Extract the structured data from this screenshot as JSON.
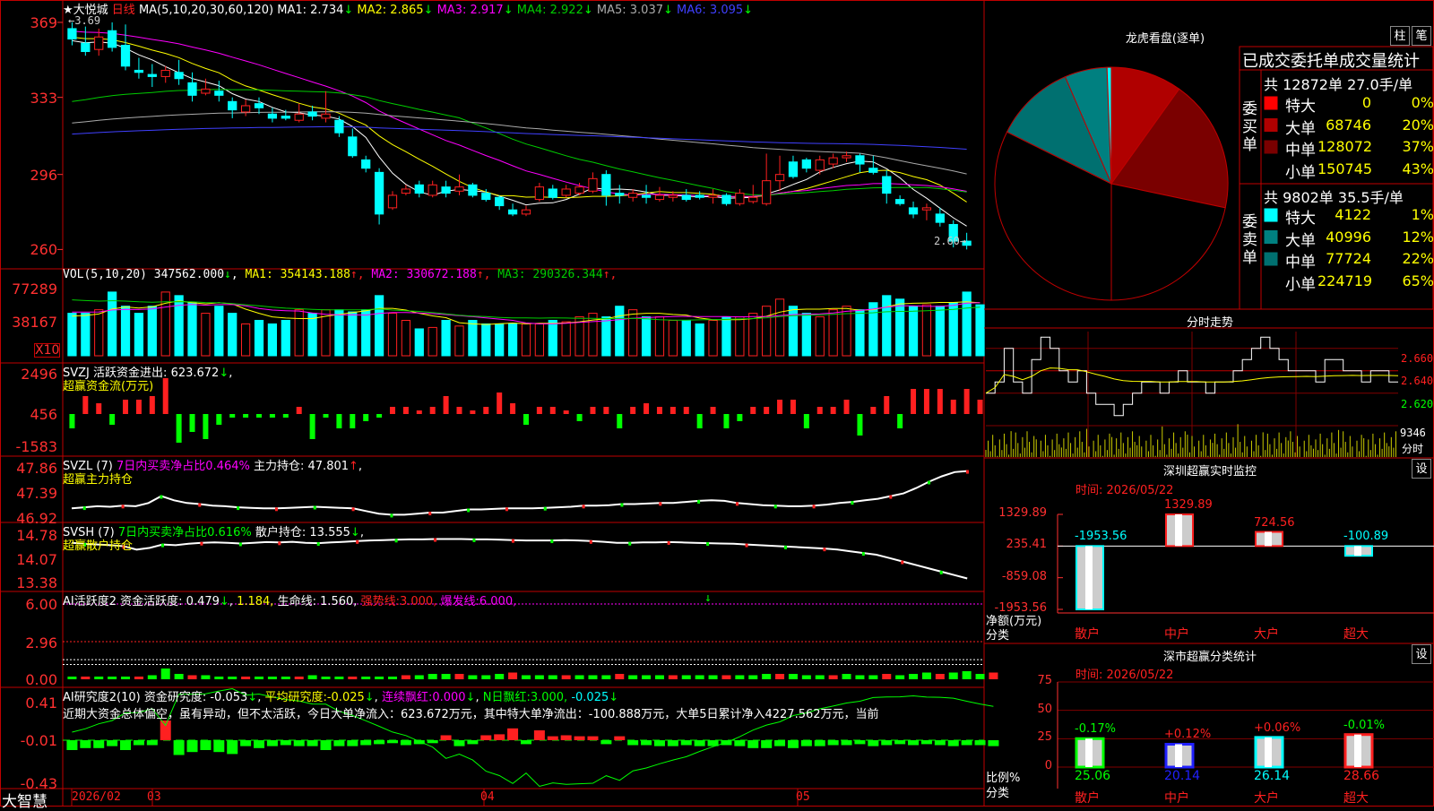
{
  "stock": {
    "name": "★大悦城",
    "period": "日线",
    "low_marker": "2.60→",
    "high_marker": "←3.69"
  },
  "colors": {
    "up": "#ff2020",
    "down": "#00ffff",
    "frame": "#c00000",
    "axis": "#ff3030",
    "ma1": "#ffffff",
    "ma2": "#ffff00",
    "ma3": "#ff00ff",
    "ma4": "#00cc00",
    "ma5": "#aaaaaa",
    "ma6": "#4040ff"
  },
  "main_chart": {
    "ma_header": {
      "label": "MA(5,10,20,30,60,120)",
      "items": [
        {
          "name": "MA1:",
          "value": "2.734",
          "arrow": "↓",
          "color": "#ffffff"
        },
        {
          "name": "MA2:",
          "value": "2.865",
          "arrow": "↓",
          "color": "#ffff00"
        },
        {
          "name": "MA3:",
          "value": "2.917",
          "arrow": "↓",
          "color": "#ff00ff"
        },
        {
          "name": "MA4:",
          "value": "2.922",
          "arrow": "↓",
          "color": "#00cc00"
        },
        {
          "name": "MA5:",
          "value": "3.037",
          "arrow": "↓",
          "color": "#aaaaaa"
        },
        {
          "name": "MA6:",
          "value": "3.095",
          "arrow": "↓",
          "color": "#4040ff"
        }
      ]
    },
    "y_ticks": [
      "369",
      "333",
      "296",
      "260"
    ],
    "y_range": [
      2.55,
      3.72
    ],
    "candles": [
      [
        3.66,
        3.69,
        3.58,
        3.61
      ],
      [
        3.59,
        3.67,
        3.53,
        3.55
      ],
      [
        3.56,
        3.66,
        3.53,
        3.62
      ],
      [
        3.65,
        3.69,
        3.55,
        3.57
      ],
      [
        3.58,
        3.68,
        3.46,
        3.48
      ],
      [
        3.46,
        3.52,
        3.42,
        3.45
      ],
      [
        3.44,
        3.49,
        3.38,
        3.43
      ],
      [
        3.43,
        3.48,
        3.4,
        3.46
      ],
      [
        3.45,
        3.51,
        3.39,
        3.42
      ],
      [
        3.4,
        3.45,
        3.31,
        3.34
      ],
      [
        3.35,
        3.42,
        3.34,
        3.37
      ],
      [
        3.36,
        3.41,
        3.31,
        3.34
      ],
      [
        3.31,
        3.33,
        3.23,
        3.27
      ],
      [
        3.26,
        3.32,
        3.24,
        3.29
      ],
      [
        3.3,
        3.33,
        3.25,
        3.28
      ],
      [
        3.25,
        3.28,
        3.21,
        3.23
      ],
      [
        3.24,
        3.27,
        3.22,
        3.23
      ],
      [
        3.22,
        3.3,
        3.21,
        3.25
      ],
      [
        3.26,
        3.29,
        3.22,
        3.24
      ],
      [
        3.23,
        3.36,
        3.21,
        3.25
      ],
      [
        3.22,
        3.24,
        3.14,
        3.16
      ],
      [
        3.14,
        3.18,
        3.04,
        3.05
      ],
      [
        3.03,
        3.05,
        2.97,
        2.99
      ],
      [
        2.97,
        2.99,
        2.72,
        2.77
      ],
      [
        2.8,
        2.88,
        2.79,
        2.86
      ],
      [
        2.87,
        2.91,
        2.86,
        2.89
      ],
      [
        2.91,
        2.93,
        2.85,
        2.87
      ],
      [
        2.86,
        2.93,
        2.85,
        2.91
      ],
      [
        2.9,
        2.93,
        2.85,
        2.87
      ],
      [
        2.88,
        2.96,
        2.86,
        2.9
      ],
      [
        2.91,
        2.92,
        2.85,
        2.86
      ],
      [
        2.87,
        2.89,
        2.83,
        2.84
      ],
      [
        2.85,
        2.86,
        2.79,
        2.81
      ],
      [
        2.79,
        2.82,
        2.76,
        2.77
      ],
      [
        2.77,
        2.81,
        2.76,
        2.79
      ],
      [
        2.84,
        2.92,
        2.83,
        2.9
      ],
      [
        2.89,
        2.91,
        2.84,
        2.85
      ],
      [
        2.86,
        2.91,
        2.85,
        2.89
      ],
      [
        2.87,
        2.92,
        2.86,
        2.9
      ],
      [
        2.88,
        2.97,
        2.87,
        2.94
      ],
      [
        2.96,
        2.98,
        2.81,
        2.86
      ],
      [
        2.87,
        2.91,
        2.82,
        2.86
      ],
      [
        2.85,
        2.89,
        2.83,
        2.87
      ],
      [
        2.86,
        2.91,
        2.82,
        2.85
      ],
      [
        2.84,
        2.9,
        2.83,
        2.86
      ],
      [
        2.85,
        2.88,
        2.83,
        2.86
      ],
      [
        2.86,
        2.89,
        2.83,
        2.84
      ],
      [
        2.86,
        2.88,
        2.84,
        2.85
      ],
      [
        2.85,
        2.89,
        2.82,
        2.86
      ],
      [
        2.86,
        2.87,
        2.81,
        2.82
      ],
      [
        2.82,
        2.89,
        2.81,
        2.87
      ],
      [
        2.83,
        2.91,
        2.82,
        2.85
      ],
      [
        2.82,
        3.06,
        2.81,
        2.93
      ],
      [
        2.93,
        3.05,
        2.88,
        2.96
      ],
      [
        3.02,
        3.05,
        2.94,
        2.95
      ],
      [
        3.03,
        3.04,
        2.97,
        2.99
      ],
      [
        2.98,
        3.05,
        2.96,
        3.03
      ],
      [
        3.01,
        3.06,
        2.99,
        3.04
      ],
      [
        3.04,
        3.07,
        3.02,
        3.05
      ],
      [
        3.05,
        3.06,
        2.97,
        3.01
      ],
      [
        2.99,
        3.05,
        2.96,
        2.97
      ],
      [
        2.95,
        2.98,
        2.82,
        2.87
      ],
      [
        2.84,
        2.86,
        2.81,
        2.82
      ],
      [
        2.8,
        2.83,
        2.75,
        2.77
      ],
      [
        2.79,
        2.82,
        2.74,
        2.8
      ],
      [
        2.77,
        2.8,
        2.71,
        2.73
      ],
      [
        2.72,
        2.74,
        2.61,
        2.64
      ],
      [
        2.64,
        2.68,
        2.6,
        2.62
      ]
    ]
  },
  "volume": {
    "header": {
      "label": "VOL(5,10,20)",
      "value": "347562.000",
      "arrow": "↓",
      "items": [
        {
          "name": "MA1:",
          "value": "354143.188",
          "arrow": "↑",
          "color": "#ffff00"
        },
        {
          "name": "MA2:",
          "value": "330672.188",
          "arrow": "↑",
          "color": "#ff00ff"
        },
        {
          "name": "MA3:",
          "value": "290326.344",
          "arrow": "↑",
          "color": "#00cc00"
        }
      ]
    },
    "y_ticks": [
      "77289",
      "38167"
    ],
    "unit": "X10",
    "bars": [
      0.6,
      0.6,
      0.65,
      0.9,
      0.7,
      0.6,
      0.7,
      0.9,
      0.85,
      0.75,
      0.6,
      0.7,
      0.6,
      0.45,
      0.5,
      0.45,
      0.5,
      0.65,
      0.6,
      0.65,
      0.65,
      0.62,
      0.65,
      0.85,
      0.6,
      0.5,
      0.38,
      0.4,
      0.5,
      0.42,
      0.5,
      0.45,
      0.45,
      0.45,
      0.45,
      0.45,
      0.5,
      0.48,
      0.55,
      0.6,
      0.55,
      0.7,
      0.65,
      0.55,
      0.55,
      0.5,
      0.5,
      0.45,
      0.5,
      0.55,
      0.55,
      0.6,
      0.7,
      0.8,
      0.7,
      0.6,
      0.55,
      0.65,
      0.7,
      0.65,
      0.75,
      0.85,
      0.8,
      0.7,
      0.72,
      0.7,
      0.75,
      0.9,
      0.72
    ]
  },
  "svzj": {
    "header_label": "SVZJ",
    "header_name": "活跃资金进出:",
    "header_value": "623.672",
    "header_arrow": "↓",
    "subtitle": "超赢资金流(万元)",
    "y_ticks": [
      "2496",
      "456",
      "-1583"
    ],
    "bars": [
      -0.4,
      0.5,
      0.3,
      -0.3,
      0.4,
      0.4,
      0.5,
      1.0,
      -0.8,
      -0.5,
      -0.7,
      -0.3,
      -0.1,
      -0.1,
      -0.1,
      -0.1,
      -0.1,
      0.2,
      -0.7,
      -0.1,
      -0.4,
      -0.4,
      -0.2,
      -0.1,
      0.2,
      0.2,
      0.1,
      0.2,
      0.5,
      0.2,
      0.1,
      0.2,
      0.6,
      0.3,
      -0.3,
      0.2,
      0.2,
      0.1,
      -0.2,
      0.2,
      0.2,
      -0.4,
      0.2,
      0.3,
      0.2,
      0.2,
      0.2,
      -0.4,
      0.2,
      -0.4,
      -0.2,
      0.2,
      0.2,
      0.4,
      0.4,
      -0.4,
      0.2,
      0.2,
      0.4,
      -0.6,
      0.2,
      0.5,
      -0.4,
      0.7,
      0.7,
      0.7,
      0.4,
      0.7,
      0.4
    ]
  },
  "svzl": {
    "header_label": "SVZL (7)",
    "header_pct_name": "7日内买卖净占比",
    "header_pct": "0.464%",
    "header_name": "主力持仓:",
    "header_value": "47.801",
    "header_arrow": "↑",
    "subtitle": "超赢主力持仓",
    "y_ticks": [
      "47.86",
      "47.39",
      "46.92"
    ],
    "line": [
      47.1,
      47.12,
      47.14,
      47.13,
      47.15,
      47.14,
      47.2,
      47.33,
      47.25,
      47.2,
      47.18,
      47.15,
      47.14,
      47.12,
      47.11,
      47.1,
      47.1,
      47.11,
      47.12,
      47.13,
      47.12,
      47.11,
      47.1,
      47.05,
      47.0,
      46.98,
      46.98,
      47.0,
      47.02,
      47.02,
      47.05,
      47.08,
      47.08,
      47.09,
      47.1,
      47.1,
      47.1,
      47.11,
      47.12,
      47.13,
      47.15,
      47.15,
      47.16,
      47.18,
      47.18,
      47.19,
      47.2,
      47.2,
      47.22,
      47.24,
      47.25,
      47.24,
      47.2,
      47.18,
      47.16,
      47.15,
      47.14,
      47.14,
      47.15,
      47.17,
      47.2,
      47.22,
      47.25,
      47.28,
      47.33,
      47.38,
      47.48,
      47.6,
      47.7,
      47.78,
      47.8
    ]
  },
  "svsh": {
    "header_label": "SVSH (7)",
    "header_pct_name": "7日内买卖净占比",
    "header_pct": "0.616%",
    "header_name": "散户持仓:",
    "header_value": "13.555",
    "header_arrow": "↓",
    "subtitle": "超赢散户持仓",
    "y_ticks": [
      "14.78",
      "14.07",
      "13.38"
    ],
    "line": [
      14.55,
      14.52,
      14.5,
      14.48,
      14.45,
      14.35,
      14.4,
      14.5,
      14.48,
      14.52,
      14.55,
      14.56,
      14.55,
      14.53,
      14.55,
      14.57,
      14.56,
      14.58,
      14.55,
      14.54,
      14.56,
      14.58,
      14.6,
      14.62,
      14.63,
      14.64,
      14.65,
      14.65,
      14.66,
      14.66,
      14.66,
      14.65,
      14.65,
      14.64,
      14.63,
      14.62,
      14.62,
      14.62,
      14.63,
      14.62,
      14.6,
      14.58,
      14.55,
      14.55,
      14.56,
      14.56,
      14.57,
      14.56,
      14.55,
      14.54,
      14.53,
      14.52,
      14.5,
      14.48,
      14.46,
      14.44,
      14.42,
      14.4,
      14.38,
      14.35,
      14.3,
      14.25,
      14.2,
      14.1,
      14.0,
      13.9,
      13.8,
      13.7,
      13.6,
      13.5
    ]
  },
  "ai_active": {
    "header": "AI活跃度2",
    "name1": "资金活跃度:",
    "value1": "0.479",
    "arrow1": "↓",
    "value1b": "1.184,",
    "name2": "生命线:",
    "value2": "1.560,",
    "name3": "强势线:",
    "value3": "3.000,",
    "name4": "爆发线:",
    "value4": "6.000,",
    "tail_arrow": "↓",
    "y_ticks": [
      "6.00",
      "2.96",
      "0.00"
    ],
    "bars": [
      0.2,
      0.2,
      0.2,
      0.2,
      0.2,
      0.2,
      0.3,
      0.8,
      0.4,
      0.3,
      0.3,
      0.2,
      0.2,
      0.2,
      0.2,
      0.2,
      0.2,
      0.2,
      0.3,
      0.2,
      0.2,
      0.2,
      0.2,
      0.2,
      0.2,
      0.3,
      0.3,
      0.4,
      0.4,
      0.4,
      0.3,
      0.3,
      0.4,
      0.5,
      0.3,
      0.3,
      0.3,
      0.3,
      0.3,
      0.3,
      0.3,
      0.4,
      0.3,
      0.3,
      0.3,
      0.3,
      0.3,
      0.3,
      0.3,
      0.3,
      0.3,
      0.3,
      0.4,
      0.4,
      0.4,
      0.3,
      0.3,
      0.3,
      0.4,
      0.3,
      0.3,
      0.4,
      0.3,
      0.4,
      0.5,
      0.4,
      0.5,
      0.6,
      0.4,
      0.5
    ]
  },
  "ai_research": {
    "header": "AI研究度2(10)",
    "name1": "资金研究度:",
    "value1": "-0.053",
    "arrow1": "↓",
    "name2": "平均研究度:",
    "value2": "-0.025",
    "arrow2": "↓",
    "name3": "连续飘红:",
    "value3": "0.000",
    "arrow3": "↓",
    "name4": "N日飘红:",
    "value4": "3.000,",
    "value4b": "-0.025",
    "arrow4": "↓",
    "commentary": "近期大资金总体偏空，虽有异动，但不太活跃，今日大单净流入：623.672万元，其中特大单净流出：-100.888万元，大单5日累计净入4227.562万元，当前",
    "y_ticks": [
      "0.41",
      "-0.01",
      "-0.43"
    ],
    "bars": [
      -0.1,
      -0.08,
      -0.08,
      -0.06,
      -0.1,
      -0.05,
      -0.05,
      0.2,
      -0.15,
      -0.12,
      -0.1,
      -0.12,
      -0.14,
      -0.06,
      -0.08,
      -0.06,
      -0.05,
      -0.06,
      -0.06,
      -0.1,
      -0.06,
      -0.06,
      -0.05,
      -0.04,
      -0.03,
      -0.05,
      -0.04,
      -0.03,
      0.05,
      -0.06,
      -0.04,
      0.05,
      0.06,
      0.12,
      -0.04,
      0.1,
      0.04,
      0.05,
      0.04,
      0.04,
      -0.04,
      0.04,
      -0.05,
      -0.05,
      -0.06,
      -0.06,
      -0.05,
      -0.06,
      -0.06,
      -0.05,
      -0.06,
      -0.08,
      -0.08,
      -0.06,
      -0.08,
      -0.06,
      -0.06,
      -0.05,
      -0.05,
      -0.04,
      -0.06,
      -0.05,
      -0.04,
      -0.05,
      -0.04,
      -0.05,
      -0.06,
      -0.05,
      -0.05,
      -0.06
    ]
  },
  "x_axis": {
    "labels": [
      "2026/02",
      "03",
      "04",
      "05"
    ],
    "brand": "大智慧"
  },
  "dragon_panel": {
    "title": "龙虎看盘(逐单)",
    "btn_bar": "柱",
    "btn_pen": "笔",
    "stats_title": "已成交委托单成交量统计",
    "buy": {
      "side": "委买单",
      "summary": "共 12872单 27.0手/单",
      "rows": [
        {
          "name": "特大",
          "value": "0",
          "pct": "0%",
          "color": "#ff0000"
        },
        {
          "name": "大单",
          "value": "68746",
          "pct": "20%",
          "color": "#b00000"
        },
        {
          "name": "中单",
          "value": "128072",
          "pct": "37%",
          "color": "#7a0000"
        },
        {
          "name": "小单",
          "value": "150745",
          "pct": "43%",
          "color": "#000000"
        }
      ]
    },
    "sell": {
      "side": "委卖单",
      "summary": "共 9802单 35.5手/单",
      "rows": [
        {
          "name": "特大",
          "value": "4122",
          "pct": "1%",
          "color": "#00ffff"
        },
        {
          "name": "大单",
          "value": "40996",
          "pct": "12%",
          "color": "#008080"
        },
        {
          "name": "中单",
          "value": "77724",
          "pct": "22%",
          "color": "#007070"
        },
        {
          "name": "小单",
          "value": "224719",
          "pct": "65%",
          "color": "#000000"
        }
      ]
    }
  },
  "intraday": {
    "title": "分时走势",
    "y_ticks": [
      "2.660",
      "2.640",
      "2.620"
    ],
    "volume_label": "9346",
    "unit_label": "分时",
    "price": [
      2.62,
      2.63,
      2.66,
      2.63,
      2.62,
      2.65,
      2.67,
      2.66,
      2.64,
      2.63,
      2.64,
      2.62,
      2.61,
      2.61,
      2.6,
      2.61,
      2.62,
      2.63,
      2.63,
      2.62,
      2.63,
      2.64,
      2.63,
      2.63,
      2.62,
      2.63,
      2.63,
      2.64,
      2.65,
      2.66,
      2.67,
      2.66,
      2.65,
      2.64,
      2.64,
      2.64,
      2.63,
      2.65,
      2.65,
      2.64,
      2.64,
      2.63,
      2.64,
      2.64,
      2.63,
      2.63
    ]
  },
  "sz_monitor": {
    "title": "深圳超赢实时监控",
    "btn_set": "设",
    "time": "时间: 2026/05/22",
    "y_ticks": [
      "1329.89",
      "235.41",
      "-859.08",
      "-1953.56"
    ],
    "unit": "净额(万元)",
    "cat_label": "分类",
    "bars": [
      {
        "name": "散户",
        "value": -1953.56,
        "label": "-1953.56",
        "color": "#00ffff"
      },
      {
        "name": "中户",
        "value": 1329.89,
        "label": "1329.89",
        "color": "#ff2020"
      },
      {
        "name": "大户",
        "value": 724.56,
        "label": "724.56",
        "color": "#ff2020"
      },
      {
        "name": "超大",
        "value": -100.89,
        "label": "-100.89",
        "color": "#00ffff"
      }
    ]
  },
  "sz_stats": {
    "title": "深市超赢分类统计",
    "btn_set": "设",
    "time": "时间: 2026/05/22",
    "y_ticks": [
      "75",
      "50",
      "25",
      "0"
    ],
    "unit": "比例%",
    "cat_label": "分类",
    "bars": [
      {
        "name": "散户",
        "value": 25.06,
        "label": "25.06",
        "chg": "-0.17%",
        "chg_color": "#00ff00",
        "color": "#00ff00"
      },
      {
        "name": "中户",
        "value": 20.14,
        "label": "20.14",
        "chg": "+0.12%",
        "chg_color": "#ff2020",
        "color": "#2020ff"
      },
      {
        "name": "大户",
        "value": 26.14,
        "label": "26.14",
        "chg": "+0.06%",
        "chg_color": "#ff2020",
        "color": "#00ffff"
      },
      {
        "name": "超大",
        "value": 28.66,
        "label": "28.66",
        "chg": "-0.01%",
        "chg_color": "#00ff00",
        "color": "#ff2020"
      }
    ]
  }
}
